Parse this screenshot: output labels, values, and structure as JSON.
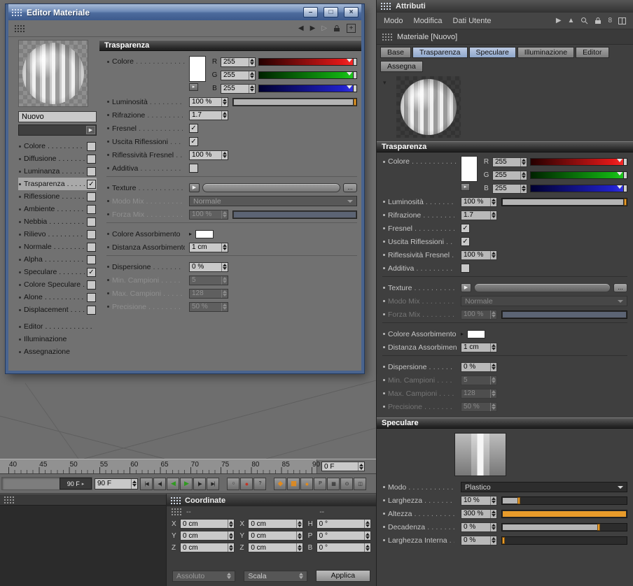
{
  "material_editor": {
    "title": "Editor Materiale",
    "window_buttons": {
      "minimize": "–",
      "maximize": "□",
      "close": "×"
    },
    "material_name": "Nuovo",
    "channels": [
      {
        "label": "Colore",
        "check": ""
      },
      {
        "label": "Diffusione",
        "check": ""
      },
      {
        "label": "Luminanza",
        "check": ""
      },
      {
        "label": "Trasparenza",
        "check": "✓",
        "selected": true
      },
      {
        "label": "Riflessione",
        "check": ""
      },
      {
        "label": "Ambiente",
        "check": ""
      },
      {
        "label": "Nebbia",
        "check": ""
      },
      {
        "label": "Rilievo",
        "check": ""
      },
      {
        "label": "Normale",
        "check": ""
      },
      {
        "label": "Alpha",
        "check": ""
      },
      {
        "label": "Speculare",
        "check": "✓"
      },
      {
        "label": "Colore Speculare",
        "check": ""
      },
      {
        "label": "Alone",
        "check": ""
      },
      {
        "label": "Displacement",
        "check": ""
      }
    ],
    "pages": [
      {
        "label": "Editor",
        "dots": true
      },
      {
        "label": "Illuminazione",
        "dots": false
      },
      {
        "label": "Assegnazione",
        "dots": false
      }
    ]
  },
  "transparency": {
    "header": "Trasparenza",
    "colore_label": "Colore",
    "r_label": "R",
    "r_val": "255",
    "g_label": "G",
    "g_val": "255",
    "b_label": "B",
    "b_val": "255",
    "luminosita_label": "Luminosità",
    "luminosita_val": "100 %",
    "rifrazione_label": "Rifrazione",
    "rifrazione_val": "1.7",
    "fresnel_label": "Fresnel",
    "fresnel_check": "✓",
    "uscita_label": "Uscita Riflessioni",
    "uscita_check": "✓",
    "rifl_fresnel_label": "Riflessività Fresnel",
    "rifl_fresnel_val": "100 %",
    "additiva_label": "Additiva",
    "additiva_check": "",
    "texture_label": "Texture",
    "texture_browse": "...",
    "modo_mix_label": "Modo Mix",
    "modo_mix_val": "Normale",
    "forza_mix_label": "Forza Mix",
    "forza_mix_val": "100 %",
    "assorb_color_label": "Colore Assorbimento",
    "assorb_dist_label": "Distanza Assorbimento",
    "assorb_dist_val": "1 cm",
    "dispersione_label": "Dispersione",
    "dispersione_val": "0 %",
    "min_campioni_label": "Min. Campioni",
    "min_campioni_val": "5",
    "max_campioni_label": "Max. Campioni",
    "max_campioni_val": "128",
    "precisione_label": "Precisione",
    "precisione_val": "50 %"
  },
  "speculare": {
    "header": "Speculare",
    "modo_label": "Modo",
    "modo_val": "Plastico",
    "larghezza_label": "Larghezza",
    "larghezza_val": "10 %",
    "altezza_label": "Altezza",
    "altezza_val": "300 %",
    "decadenza_label": "Decadenza",
    "decadenza_val": "0 %",
    "larghezza_interna_label": "Larghezza Interna",
    "larghezza_interna_val": "0 %"
  },
  "attributes": {
    "title": "Attributi",
    "menu": {
      "modo": "Modo",
      "modifica": "Modifica",
      "dati_utente": "Dati Utente"
    },
    "object_title": "Materiale [Nuovo]",
    "tabs": [
      {
        "label": "Base",
        "active": false
      },
      {
        "label": "Trasparenza",
        "active": true
      },
      {
        "label": "Speculare",
        "active": true
      },
      {
        "label": "Illuminazione",
        "active": false
      },
      {
        "label": "Editor",
        "active": false
      }
    ],
    "assegna_tab": "Assegna",
    "eight_icon": "8"
  },
  "timeline": {
    "ticks": [
      "40",
      "45",
      "50",
      "55",
      "60",
      "65",
      "70",
      "75",
      "80",
      "85",
      "90"
    ],
    "frame_field": "0 F"
  },
  "transport": {
    "range_end": "90 F",
    "current_frame": "90 F",
    "playback": [
      {
        "g": "|◀"
      },
      {
        "g": "◀|"
      },
      {
        "g": "◀",
        "green": true
      },
      {
        "g": "▶",
        "green": true
      },
      {
        "g": "|▶"
      },
      {
        "g": "▶|"
      }
    ],
    "records": [
      {
        "g": "○"
      },
      {
        "g": "●",
        "red": true
      },
      {
        "g": "?",
        "orange": true
      }
    ],
    "tools": [
      {
        "g": "◆",
        "orange": true
      },
      {
        "g": "▩",
        "orange": true
      },
      {
        "g": "●",
        "orange": true
      },
      {
        "g": "P"
      },
      {
        "g": "▦"
      },
      {
        "g": "⊙"
      },
      {
        "g": "◫"
      }
    ]
  },
  "coordinates": {
    "title": "Coordinate",
    "dash_left": "--",
    "dash_right": "--",
    "px_l": "X",
    "px_v": "0 cm",
    "py_l": "Y",
    "py_v": "0 cm",
    "pz_l": "Z",
    "pz_v": "0 cm",
    "sx_l": "X",
    "sx_v": "0 cm",
    "sy_l": "Y",
    "sy_v": "0 cm",
    "sz_l": "Z",
    "sz_v": "0 cm",
    "rh_l": "H",
    "rh_v": "0 °",
    "rp_l": "P",
    "rp_v": "0 °",
    "rb_l": "B",
    "rb_v": "0 °",
    "mode_dropdown": "Assoluto",
    "size_dropdown": "Scala",
    "apply_button": "Applica"
  },
  "icons": {
    "back": "◀",
    "forward": "▶",
    "ghost": "▷",
    "plus": "+",
    "expand_right": "▸",
    "expand_down": "▾",
    "texture_arrow": "▶",
    "menu_forward": "▶",
    "menu_up": "▲"
  },
  "colors": {
    "accent_orange": "#e89b2a",
    "tab_active_blue": "#a9bcd9",
    "titlebar_blue": "#5b7db1"
  }
}
